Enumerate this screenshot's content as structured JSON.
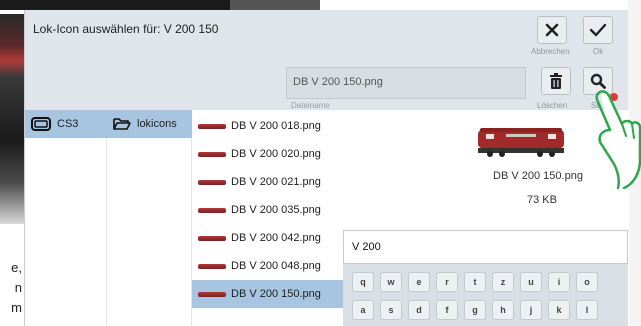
{
  "dialog": {
    "title": "Lok-Icon auswählen für: V 200 150",
    "cancel_label": "Abbrechen",
    "ok_label": "Ok",
    "filename_value": "DB V 200 150.png",
    "filename_label": "Dateiname",
    "delete_label": "Löschen",
    "search_label": "Su"
  },
  "columns": {
    "cs3_label": "CS3",
    "lokicons_label": "lokicons"
  },
  "files": [
    {
      "name": "DB V 200 018.png"
    },
    {
      "name": "DB V 200 020.png"
    },
    {
      "name": "DB V 200 021.png"
    },
    {
      "name": "DB V 200 035.png"
    },
    {
      "name": "DB V 200 042.png"
    },
    {
      "name": "DB V 200 048.png"
    },
    {
      "name": "DB V 200 150.png"
    }
  ],
  "selected_file_index": 6,
  "preview": {
    "name": "DB V 200 150.png",
    "size": "73 KB"
  },
  "keyboard": {
    "input_value": "V 200",
    "row1": [
      "q",
      "w",
      "e",
      "r",
      "t",
      "z",
      "u",
      "i",
      "o"
    ],
    "row2": [
      "a",
      "s",
      "d",
      "f",
      "g",
      "h",
      "j",
      "k",
      "l"
    ]
  },
  "background_text": [
    "e,",
    "n",
    "m"
  ],
  "colors": {
    "selection": "#a7c5e1",
    "dialog_bg": "#dfe5ea",
    "notification_dot": "#e53935"
  }
}
